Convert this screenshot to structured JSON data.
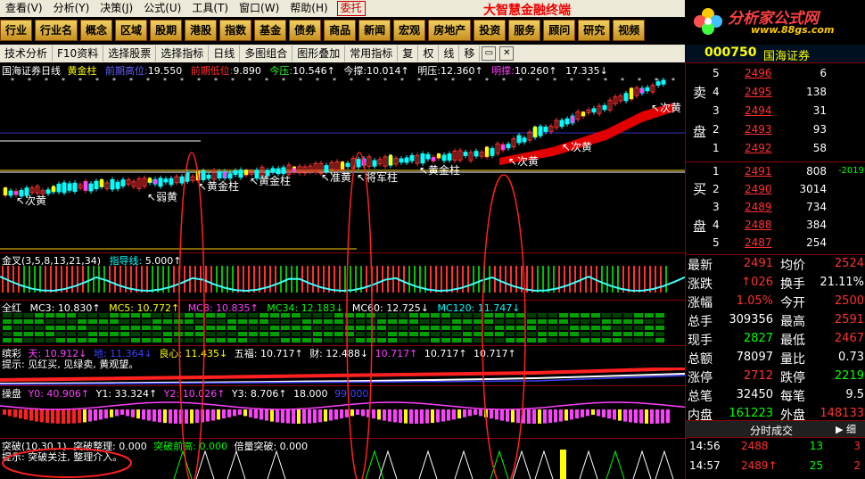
{
  "menu": {
    "items": [
      "查看(V)",
      "分析(Y)",
      "决策(J)",
      "公式(U)",
      "工具(T)",
      "窗口(W)",
      "帮助(H)"
    ],
    "trust_label": "委托",
    "brand": "大智慧金融终端"
  },
  "logo": {
    "title": "分析家公式网",
    "url_text": "www.88gs.com"
  },
  "categories": [
    "行业",
    "行业名",
    "概念",
    "区域",
    "股期",
    "港股",
    "指数",
    "基金",
    "债券",
    "商品",
    "新闻",
    "宏观",
    "房地产",
    "投资",
    "服务",
    "顾问",
    "研究",
    "视频"
  ],
  "toolbar": {
    "items": [
      "技术分析",
      "F10资料",
      "选择股票",
      "选择指标",
      "日线",
      "多图组合",
      "图形叠加",
      "常用指标"
    ],
    "icons": [
      "复",
      "权",
      "线",
      "移"
    ]
  },
  "stock": {
    "code": "000750",
    "name": "国海证券"
  },
  "main_chart": {
    "title": "国海证券日线",
    "indicator": "黄金柱",
    "fields": [
      {
        "label": "前期高位:",
        "value": "19.550",
        "color": "#6060ff"
      },
      {
        "label": "前期低位:",
        "value": "9.890",
        "color": "#ff3030"
      },
      {
        "label": "今压:",
        "value": "10.546↑",
        "color": "#30ff30"
      },
      {
        "label": "今撑:",
        "value": "10.014↑",
        "color": "#ffffff"
      },
      {
        "label": "明压:",
        "value": "12.360↑",
        "color": "#ffffff"
      },
      {
        "label": "明撑:",
        "value": "10.260↑",
        "color": "#ff40ff"
      },
      {
        "label": "",
        "value": "17.335↓",
        "color": "#ffffff"
      }
    ],
    "annotations": [
      "次黄",
      "黄金柱",
      "黄金柱",
      "准黄",
      "将军柱",
      "黄金柱",
      "次黄",
      "次黄",
      "次黄",
      "弱黄"
    ]
  },
  "panel_guide": {
    "name": "金叉(3,5,8,13,21,34)",
    "label": "指导线:",
    "value": "5.000↑"
  },
  "panel_ma": {
    "name": "全红",
    "fields": [
      "MC3: 10.830↑",
      "MC5: 10.772↑",
      "MC8: 10.835↑",
      "MC34: 12.183↓",
      "MC60: 12.725↓",
      "MC120: 11.747↓"
    ]
  },
  "panel_color": {
    "name": "缤彩",
    "fields": [
      "天: 10.912↓",
      "地: 11.364↓",
      "良心: 11.435↓",
      "五福: 10.717↑",
      "财: 12.488↓",
      "10.717↑",
      "10.717↑",
      "10.717↑"
    ],
    "hint": "提示: 见红买, 见绿卖, 黄观望。"
  },
  "panel_operate": {
    "name": "操盘",
    "fields": [
      "Y0: 40.906↑",
      "Y1: 33.324↑",
      "Y2: 10.026↑",
      "Y3: 8.706↑",
      "18.000",
      "99.000"
    ]
  },
  "panel_break": {
    "name": "突破(10,30,1)",
    "fields": [
      "突破整理: 0.000",
      "突破前高: 0.000",
      "倍量突破: 0.000"
    ],
    "hint": "提示: 突破关注, 整理介入。"
  },
  "orderbook": {
    "sell_label": [
      "卖",
      "盘"
    ],
    "buy_label": [
      "买",
      "盘"
    ],
    "sell": [
      {
        "level": "5",
        "price": "2496",
        "vol": "6"
      },
      {
        "level": "4",
        "price": "2495",
        "vol": "138"
      },
      {
        "level": "3",
        "price": "2494",
        "vol": "31"
      },
      {
        "level": "2",
        "price": "2493",
        "vol": "93"
      },
      {
        "level": "1",
        "price": "2492",
        "vol": "58"
      }
    ],
    "buy": [
      {
        "level": "1",
        "price": "2491",
        "vol": "808",
        "chg": "-2019"
      },
      {
        "level": "2",
        "price": "2490",
        "vol": "3014",
        "chg": ""
      },
      {
        "level": "3",
        "price": "2489",
        "vol": "734",
        "chg": ""
      },
      {
        "level": "4",
        "price": "2488",
        "vol": "384",
        "chg": ""
      },
      {
        "level": "5",
        "price": "2487",
        "vol": "254",
        "chg": ""
      }
    ]
  },
  "stats": [
    {
      "l1": "最新",
      "v1": "2491",
      "c1": "#ff3030",
      "l2": "均价",
      "v2": "2524",
      "c2": "#ff3030"
    },
    {
      "l1": "涨跌",
      "v1": "↑026",
      "c1": "#ff3030",
      "l2": "换手",
      "v2": "21.11%",
      "c2": "#ffffff"
    },
    {
      "l1": "涨幅",
      "v1": "1.05%",
      "c1": "#ff3030",
      "l2": "今开",
      "v2": "2500",
      "c2": "#ff3030"
    },
    {
      "l1": "总手",
      "v1": "309356",
      "c1": "#ffffff",
      "l2": "最高",
      "v2": "2591",
      "c2": "#ff3030"
    },
    {
      "l1": "现手",
      "v1": "2827",
      "c1": "#00ff00",
      "l2": "最低",
      "v2": "2467",
      "c2": "#ff3030"
    },
    {
      "l1": "总额",
      "v1": "78097",
      "c1": "#ffffff",
      "l2": "量比",
      "v2": "0.73",
      "c2": "#ffffff"
    },
    {
      "l1": "涨停",
      "v1": "2712",
      "c1": "#ff3030",
      "l2": "跌停",
      "v2": "2219",
      "c2": "#00ff00"
    },
    {
      "l1": "总笔",
      "v1": "32450",
      "c1": "#ffffff",
      "l2": "每笔",
      "v2": "9.5",
      "c2": "#ffffff"
    },
    {
      "l1": "内盘",
      "v1": "161223",
      "c1": "#00ff00",
      "l2": "外盘",
      "v2": "148133",
      "c2": "#ff3030"
    }
  ],
  "ticks_header": "分时成交",
  "ticks": [
    {
      "time": "14:56",
      "price": "2488",
      "vol": "13",
      "dir": "3"
    },
    {
      "time": "14:57",
      "price": "2489↑",
      "vol": "25",
      "dir": "2"
    }
  ],
  "colors": {
    "up": "#ff3030",
    "down": "#00ff00",
    "neutral": "#ffffff",
    "accent": "#ffff00",
    "border": "#800000"
  }
}
